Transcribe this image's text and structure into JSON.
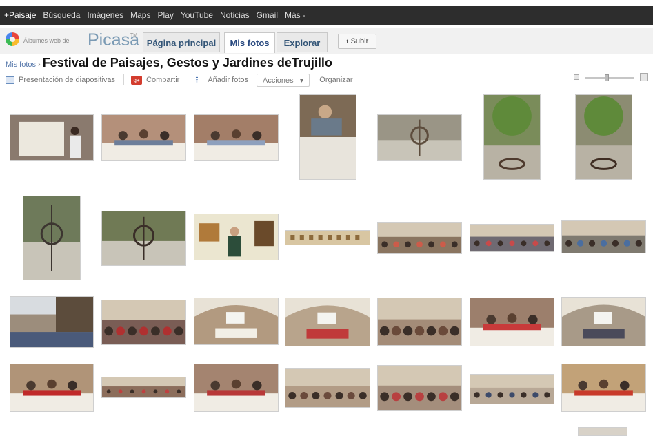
{
  "topbar": {
    "items": [
      "+Paisaje",
      "Búsqueda",
      "Imágenes",
      "Maps",
      "Play",
      "YouTube",
      "Noticias",
      "Gmail",
      "Más -"
    ]
  },
  "app": {
    "logo_small": "Álbumes web de",
    "logo_big": "Picasa",
    "logo_sup": "TM",
    "tabs": [
      {
        "label": "Página principal",
        "active": false
      },
      {
        "label": "Mis fotos",
        "active": true
      },
      {
        "label": "Explorar",
        "active": false
      }
    ],
    "upload_label": "Subir"
  },
  "breadcrumb": {
    "link": "Mis fotos",
    "separator": "›",
    "album_title": "Festival de Paisajes, Gestos y Jardines deTrujillo"
  },
  "toolbar": {
    "slideshow": "Presentación de diapositivas",
    "share": "Compartir",
    "add_photos": "Añadir fotos",
    "actions": "Acciones",
    "organize": "Organizar"
  },
  "zoom": {
    "level": 0.45
  },
  "photos": [
    {
      "bg": "#8a7a6e",
      "accent": "#ece8de",
      "kind": "presentation"
    },
    {
      "bg": "#b4907a",
      "accent": "#6d7e9a",
      "kind": "meeting"
    },
    {
      "bg": "#a37e68",
      "accent": "#8ea0bd",
      "kind": "meeting"
    },
    {
      "bg": "#7d6a55",
      "accent": "#e8e4dc",
      "kind": "portrait"
    },
    {
      "bg": "#9a9586",
      "accent": "#5d4d3d",
      "kind": "sculpture"
    },
    {
      "bg": "#7a8c5a",
      "accent": "#4f3b2e",
      "kind": "plant"
    },
    {
      "bg": "#8c8c72",
      "accent": "#3f2d22",
      "kind": "plant"
    },
    {
      "bg": "#6e7a5a",
      "accent": "#3c3530",
      "kind": "sculpture"
    },
    {
      "bg": "#707a55",
      "accent": "#3a2e28",
      "kind": "sculpture"
    },
    {
      "bg": "#ebe6d0",
      "accent": "#2c4d3a",
      "kind": "exhibit"
    },
    {
      "bg": "#d8c6a2",
      "accent": "#8c6a3c",
      "kind": "panorama"
    },
    {
      "bg": "#8a7560",
      "accent": "#cc5c4a",
      "kind": "crowd"
    },
    {
      "bg": "#6f6a72",
      "accent": "#c84a4a",
      "kind": "crowd"
    },
    {
      "bg": "#7f7a70",
      "accent": "#4a6ea0",
      "kind": "crowd"
    },
    {
      "bg": "#9c8d7c",
      "accent": "#5c4c3c",
      "kind": "courtyard"
    },
    {
      "bg": "#7a5d55",
      "accent": "#b03030",
      "kind": "crowd"
    },
    {
      "bg": "#b29a80",
      "accent": "#f2efe6",
      "kind": "hall"
    },
    {
      "bg": "#b8a48c",
      "accent": "#c03a3a",
      "kind": "hall"
    },
    {
      "bg": "#a48c78",
      "accent": "#6a4a3a",
      "kind": "crowd"
    },
    {
      "bg": "#9c7f6c",
      "accent": "#c83a3a",
      "kind": "meeting"
    },
    {
      "bg": "#a89a88",
      "accent": "#4a4a5a",
      "kind": "hall"
    },
    {
      "bg": "#b09478",
      "accent": "#c02a2a",
      "kind": "meeting"
    },
    {
      "bg": "#8c6e5c",
      "accent": "#c04040",
      "kind": "crowd"
    },
    {
      "bg": "#a48470",
      "accent": "#b83838",
      "kind": "meeting"
    },
    {
      "bg": "#b29c86",
      "accent": "#6a4a3c",
      "kind": "crowd"
    },
    {
      "bg": "#a48e7c",
      "accent": "#b84040",
      "kind": "crowd"
    },
    {
      "bg": "#b8a896",
      "accent": "#3c4a6a",
      "kind": "crowd"
    },
    {
      "bg": "#c2a278",
      "accent": "#c83a2a",
      "kind": "meeting"
    }
  ]
}
